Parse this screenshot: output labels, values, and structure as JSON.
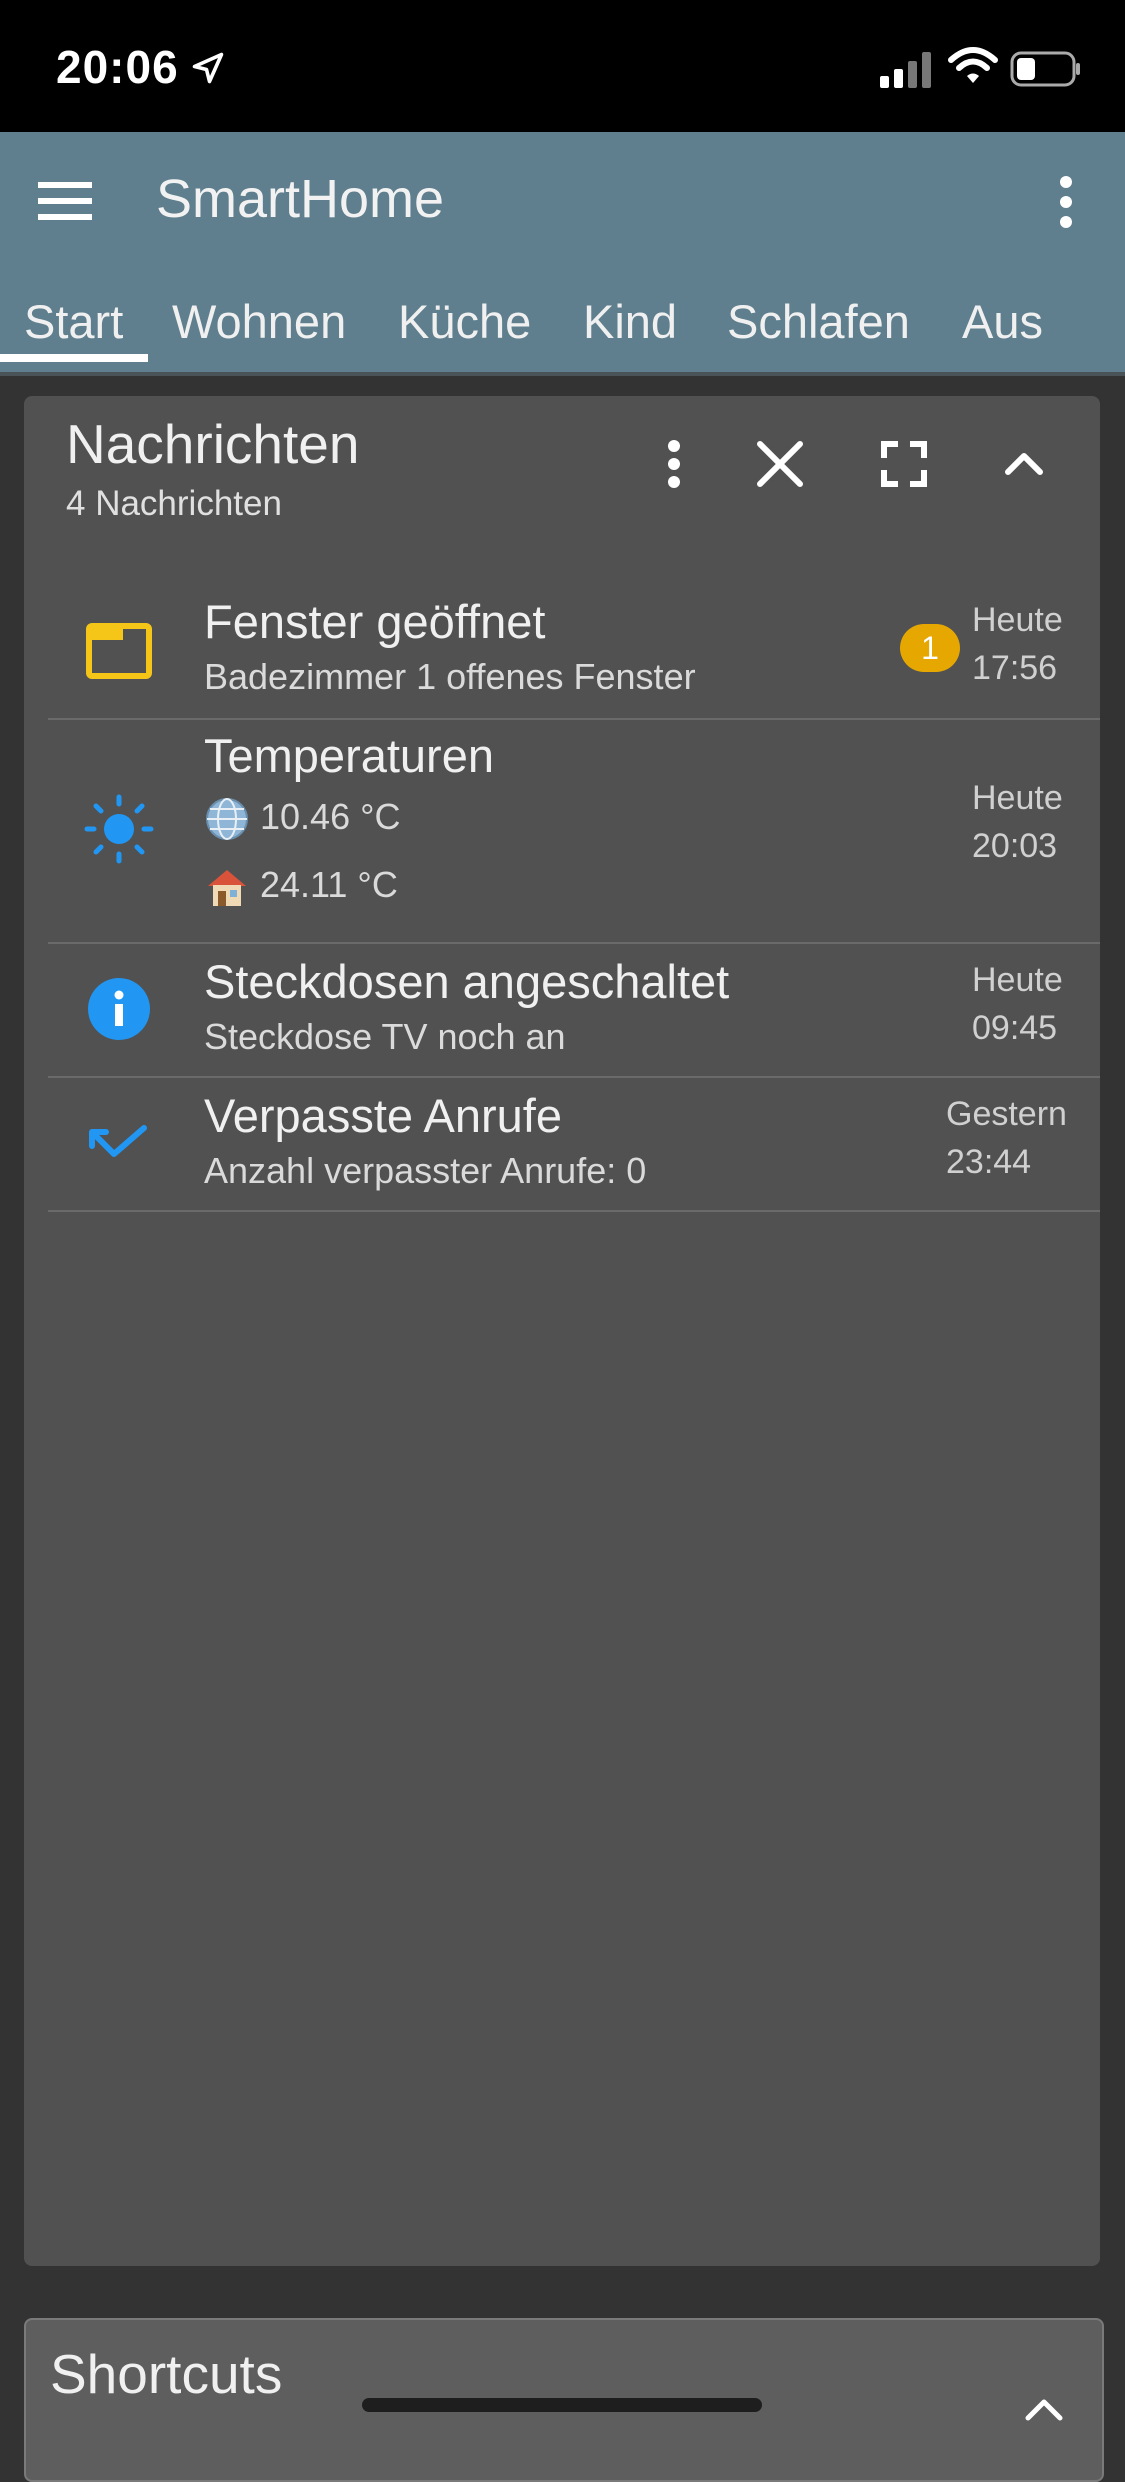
{
  "status_bar": {
    "time": "20:06",
    "icons": [
      "location-arrow-icon",
      "cellular-signal-icon",
      "wifi-icon",
      "battery-icon"
    ]
  },
  "app_bar": {
    "title": "SmartHome",
    "background_color": "#5f7f8e",
    "tabs": [
      {
        "label": "Start",
        "active": true
      },
      {
        "label": "Wohnen",
        "active": false
      },
      {
        "label": "Küche",
        "active": false
      },
      {
        "label": "Kind",
        "active": false
      },
      {
        "label": "Schlafen",
        "active": false
      },
      {
        "label": "Aus",
        "active": false
      }
    ]
  },
  "notifications_card": {
    "title": "Nachrichten",
    "subtitle": "4 Nachrichten",
    "actions": [
      "more-vert-icon",
      "close-icon",
      "fullscreen-icon",
      "collapse-icon"
    ],
    "messages": [
      {
        "icon": "window-icon",
        "icon_color": "#f5c518",
        "title": "Fenster geöffnet",
        "text": "Badezimmer 1 offenes Fenster",
        "badge": "1",
        "time_day": "Heute",
        "time_clock": "17:56"
      },
      {
        "icon": "sun-icon",
        "icon_color": "#2196f3",
        "title": "Temperaturen",
        "line1": "10.46 °C",
        "line2": "24.11 °C",
        "time_day": "Heute",
        "time_clock": "20:03"
      },
      {
        "icon": "info-icon",
        "icon_color": "#2196f3",
        "title": "Steckdosen angeschaltet",
        "text": "Steckdose TV noch an",
        "time_day": "Heute",
        "time_clock": "09:45"
      },
      {
        "icon": "missed-call-icon",
        "icon_color": "#2196f3",
        "title": "Verpasste Anrufe",
        "text": "Anzahl verpasster Anrufe: 0",
        "time_day": "Gestern",
        "time_clock": "23:44"
      }
    ]
  },
  "shortcuts_card": {
    "title": "Shortcuts"
  }
}
